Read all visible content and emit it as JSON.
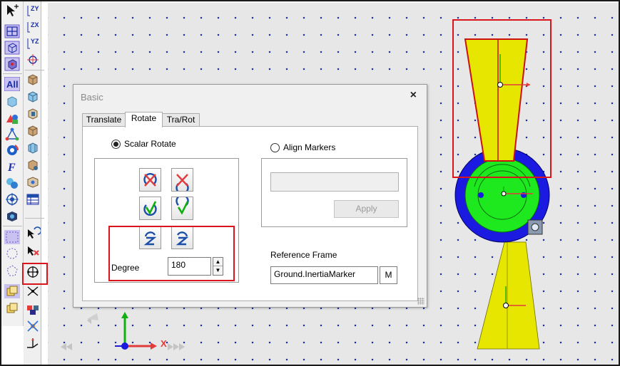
{
  "dialog": {
    "title": "Basic",
    "close_label": "×",
    "tabs": [
      "Translate",
      "Rotate",
      "Tra/Rot"
    ],
    "active_tab": "Rotate",
    "scalar_rotate_label": "Scalar Rotate",
    "align_markers_label": "Align Markers",
    "scalar_rotate_selected": true,
    "align_markers_selected": false,
    "degree_label": "Degree",
    "degree_value": "180",
    "align_input_value": "",
    "apply_label": "Apply",
    "apply_enabled": false,
    "reference_frame_label": "Reference Frame",
    "reference_frame_value": "Ground.InertiaMarker",
    "m_button_label": "M"
  },
  "triad": {
    "x_label": "X"
  },
  "toolbar": {
    "zy_label": "ZY",
    "zx_label": "ZX",
    "yz_label": "YZ",
    "all_label": "All",
    "f_label": "F"
  },
  "colors": {
    "model_yellow": "#e6e600",
    "hub_green": "#1ee81e",
    "hub_blue": "#1a1ae0",
    "highlight_red": "#d9141b",
    "grid_dot": "#1c2fa8"
  }
}
